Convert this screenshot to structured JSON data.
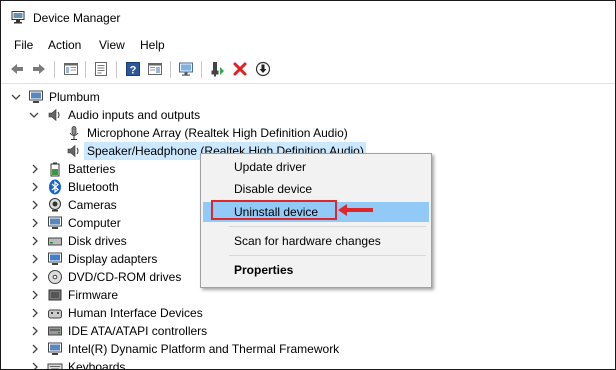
{
  "window": {
    "title": "Device Manager"
  },
  "menu": [
    "File",
    "Action",
    "View",
    "Help"
  ],
  "toolbar_icons": [
    "back-arrow-icon",
    "forward-arrow-icon",
    "show-hide-console-tree-icon",
    "properties-icon",
    "help-icon",
    "action-pane-icon",
    "monitor-icon",
    "update-driver-icon",
    "uninstall-device-icon",
    "scan-download-icon"
  ],
  "tree": {
    "root": "Plumbum",
    "audio_category": "Audio inputs and outputs",
    "microphone": "Microphone Array (Realtek High Definition Audio)",
    "speaker": "Speaker/Headphone (Realtek High Definition Audio)",
    "categories": [
      "Batteries",
      "Bluetooth",
      "Cameras",
      "Computer",
      "Disk drives",
      "Display adapters",
      "DVD/CD-ROM drives",
      "Firmware",
      "Human Interface Devices",
      "IDE ATA/ATAPI controllers",
      "Intel(R) Dynamic Platform and Thermal Framework",
      "Keyboards"
    ]
  },
  "context_menu": {
    "update": "Update driver",
    "disable": "Disable device",
    "uninstall": "Uninstall device",
    "scan": "Scan for hardware changes",
    "properties": "Properties"
  },
  "colors": {
    "selection": "#cce8ff",
    "menu_highlight": "#91c9f7",
    "annotation": "#e1262b"
  }
}
